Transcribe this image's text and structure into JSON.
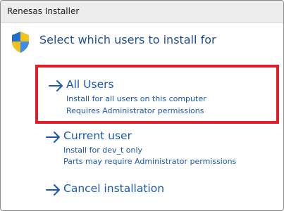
{
  "window": {
    "title": "Renesas Installer"
  },
  "heading": "Select which users to install for",
  "options": [
    {
      "label": "All Users",
      "lines": [
        "Install for all users on this computer",
        "Requires Administrator permissions"
      ]
    },
    {
      "label": "Current user",
      "lines": [
        "Install for dev_t only",
        "Parts may require Administrator permissions"
      ]
    },
    {
      "label": "Cancel installation",
      "lines": []
    }
  ],
  "colors": {
    "link": "#1a57b7",
    "highlight": "#e21d2a",
    "heading": "#1f4e9a"
  },
  "icons": {
    "shield": "uac-shield-icon",
    "arrow": "right-arrow-icon"
  }
}
